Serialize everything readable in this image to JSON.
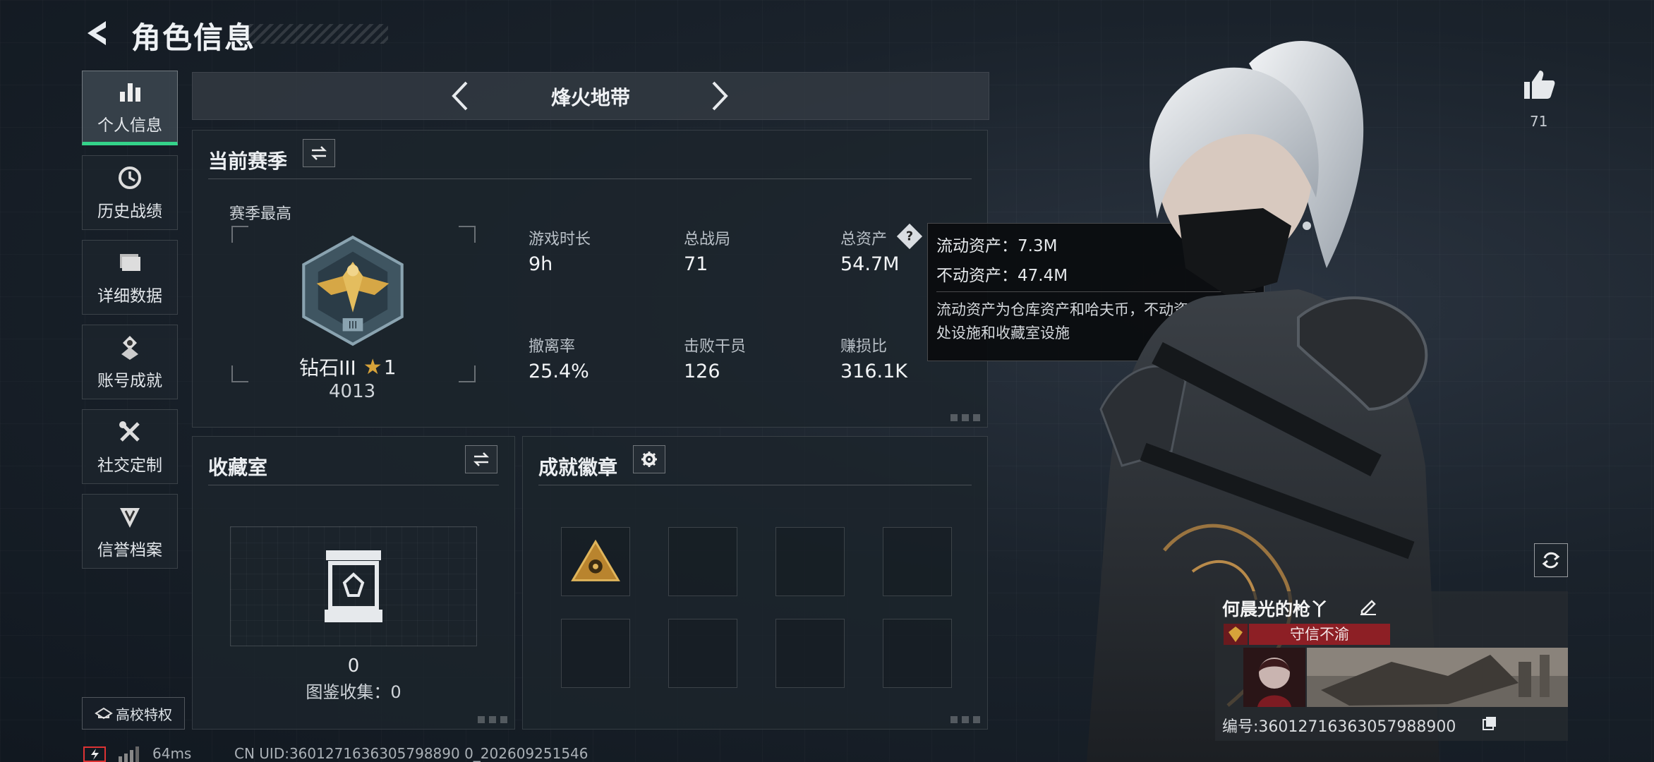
{
  "header": {
    "title": "角色信息"
  },
  "nav": {
    "items": [
      {
        "label": "个人信息"
      },
      {
        "label": "历史战绩"
      },
      {
        "label": "详细数据"
      },
      {
        "label": "账号成就"
      },
      {
        "label": "社交定制"
      },
      {
        "label": "信誉档案"
      }
    ],
    "campus_label": "高校特权"
  },
  "mode": {
    "title": "烽火地带"
  },
  "season": {
    "title": "当前赛季",
    "best_label": "赛季最高",
    "rank_name": "钻石III",
    "rank_stars": "1",
    "rank_score": "4013",
    "stats": [
      {
        "label": "游戏时长",
        "value": "9h"
      },
      {
        "label": "总战局",
        "value": "71"
      },
      {
        "label": "总资产",
        "value": "54.7M"
      },
      {
        "label": "撤离率",
        "value": "25.4%"
      },
      {
        "label": "击败干员",
        "value": "126"
      },
      {
        "label": "赚损比",
        "value": "316.1K"
      }
    ]
  },
  "tooltip": {
    "liquid": "流动资产：7.3M",
    "fixed": "不动资产：47.4M",
    "desc": "流动资产为仓库资产和哈夫币，不动资产为特勤处设施和收藏室设施"
  },
  "collection": {
    "title": "收藏室",
    "count": "0",
    "codex_label": "图鉴收集：0"
  },
  "badges": {
    "title": "成就徽章"
  },
  "profile": {
    "likes": "71",
    "player_name": "何晨光的枪丫",
    "player_title": "守信不渝",
    "id_label": "编号:3601271636305798890​0"
  },
  "footer": {
    "ping": "64ms",
    "uid": "CN UID:3601271636305798890 0_202609251546"
  },
  "colors": {
    "accent_green": "#34d38a",
    "title_red": "#8d1f25",
    "gold": "#d7a33a"
  }
}
